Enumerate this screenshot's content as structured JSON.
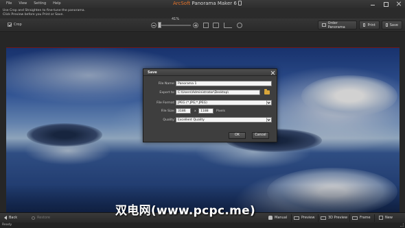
{
  "menu": {
    "items": [
      "File",
      "View",
      "Setting",
      "Help"
    ]
  },
  "app": {
    "brand": "ArcSoft",
    "title": " Panorama Maker 6"
  },
  "instructions": {
    "line1": "Use Crop and Straighten to fine-tune the panorama.",
    "line2": "Click Preview before you Print or Save."
  },
  "toolbar": {
    "crop_label": "Crop",
    "zoom_percent": "41%",
    "zoom_level": 0.05,
    "order_label": "Order Panorama",
    "print_label": "Print",
    "save_label": "Save"
  },
  "dialog": {
    "title": "Save",
    "file_name_label": "File Name:",
    "file_name_value": "Panorama 1",
    "export_label": "Export to:",
    "export_value": "C:\\Users\\Administrator\\Desktop\\",
    "format_label": "File Format:",
    "format_value": "JPEG (*.JPG;*.JPEG)",
    "size_label": "File Size:",
    "width_value": "3186",
    "size_x": "x",
    "height_value": "1188",
    "size_unit": "Pixels",
    "quality_label": "Quality:",
    "quality_value": "Excellent Quality",
    "ok_label": "OK",
    "cancel_label": "Cancel"
  },
  "bottombar": {
    "back_label": "Back",
    "restore_label": "Restore",
    "manual_label": "Manual",
    "preview_label": "Preview",
    "preview3d_label": "3D Preview",
    "frame_label": "Frame",
    "new_label": "New"
  },
  "status": {
    "text": "Ready"
  },
  "watermark": {
    "text": "双电网(www.pcpc.me)"
  }
}
